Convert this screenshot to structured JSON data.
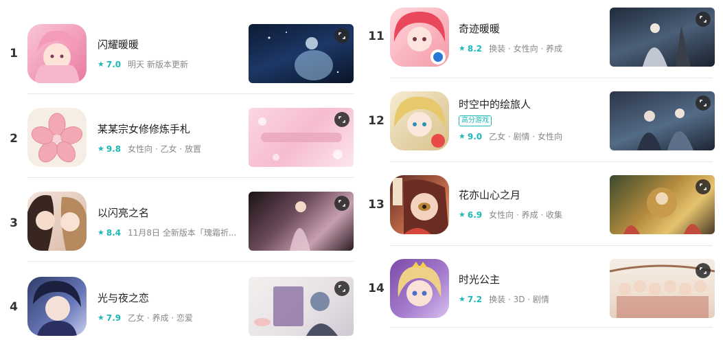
{
  "left_list": [
    {
      "rank": "1",
      "name": "闪耀暖暖",
      "score": "7.0",
      "tags": "明天 新版本更新"
    },
    {
      "rank": "2",
      "name": "某某宗女修修炼手札",
      "score": "9.8",
      "tags": "女性向 · 乙女 · 放置"
    },
    {
      "rank": "3",
      "name": "以闪亮之名",
      "score": "8.4",
      "tags": "11月8日 全新版本「瑰霜祈..."
    },
    {
      "rank": "4",
      "name": "光与夜之恋",
      "score": "7.9",
      "tags": "乙女 · 养成 · 恋爱"
    }
  ],
  "right_list": [
    {
      "rank": "11",
      "name": "奇迹暖暖",
      "score": "8.2",
      "tags": "换装 · 女性向 · 养成"
    },
    {
      "rank": "12",
      "name": "时空中的绘旅人",
      "badge": "高分游戏",
      "score": "9.0",
      "tags": "乙女 · 剧情 · 女性向"
    },
    {
      "rank": "13",
      "name": "花亦山心之月",
      "score": "6.9",
      "tags": "女性向 · 养成 · 收集"
    },
    {
      "rank": "14",
      "name": "时光公主",
      "score": "7.2",
      "tags": "换装 · 3D · 剧情"
    }
  ],
  "icons": {
    "rating": "star-icon",
    "media": "expand-icon"
  },
  "colors": {
    "accent": "#1cb9b7",
    "divider": "#e6e6e6",
    "text": "#222222",
    "meta": "#888888"
  }
}
